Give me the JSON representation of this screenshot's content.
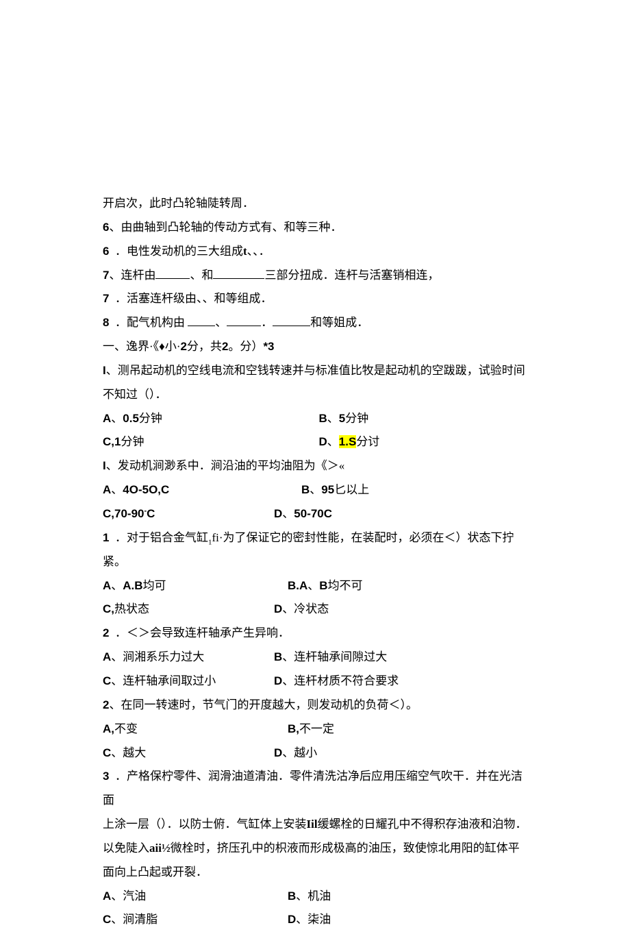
{
  "l0": "开启次，此时凸轮轴陡转周．",
  "l1a": "6",
  "l1b": "、由曲轴到凸轮轴的传动方式有、和等三种．",
  "l2a": "6",
  "l2b": "．电性发动机的三大组成",
  "l2c": "t",
  "l2d": "、、．",
  "l3a": "7",
  "l3b": "、连杆由",
  "l3c": "、和",
  "l3d": "三部分扭成．连杆与活塞销相连，",
  "l4a": "7",
  "l4b": "．活塞连杆级由、、和等组成．",
  "l5a": "8",
  "l5b": "．配气机构由 ",
  "l5c": "、",
  "l5d": "．",
  "l5e": "和等姐成．",
  "l6": "一、逸界·《♦小·",
  "l6b": "2",
  "l6c": "分，共",
  "l6d": "2",
  "l6e": "。分）",
  "l6f": "*3",
  "l7a": "I",
  "l7b": "、测吊起动机的空线电流和空钱转速并与标准值比牧是起动机的空跋跋，试验时间",
  "l8": "不知过（）．",
  "q1a1": "A",
  "q1a1t": "、",
  "q1a1v": "0.5",
  "q1a1s": "分钟",
  "q1b1": "B",
  "q1b1t": "、",
  "q1b1v": "5",
  "q1b1s": "分钟",
  "q1c1": "C,1",
  "q1c1s": "分钟",
  "q1d1": "D",
  "q1d1t": "、",
  "q1d1v": "1.S",
  "q1d1s": "分讨",
  "l11a": "I",
  "l11b": "、发动机涧渺系中．涧沿油的平均油阻为《＞«",
  "q2a": "A",
  "q2at": "、",
  "q2av": "4O-5O,C",
  "q2b": "B",
  "q2bt": "、",
  "q2bv": "95",
  "q2bs": "匕以上",
  "q2c": "C,70-90",
  "q2cs": "-",
  "q2ce": "C",
  "q2d": "D",
  "q2dt": "、",
  "q2dv": "50-70C",
  "l14a": "1",
  "l14b": "．对于铝合金气缸",
  "l14c": "1",
  "l14d": "fi·为了保证它的密封性能，在装配时，必须在＜）状态下拧紧。",
  "q3a": "A",
  "q3at": "、",
  "q3av": "A.B",
  "q3as": "均可",
  "q3b": "B.A",
  "q3bt": "、",
  "q3bv": "B",
  "q3bs": "均不可",
  "q3c": "C,",
  "q3cs": "热状态",
  "q3d": "D",
  "q3dt": "、冷状态",
  "l17a": "2",
  "l17b": "．＜＞会导致连杆轴承产生异响．",
  "q4a": "A",
  "q4at": "、涧湘系乐力过大",
  "q4b": "B",
  "q4bt": "、连杆轴承间隙过大",
  "q4c": "C",
  "q4ct": "、连杆轴承间取过小",
  "q4d": "D",
  "q4dt": "、连杆材质不符合要求",
  "l20a": "2",
  "l20b": "、在同一转速时，节气门的开度越大，则发动机的负荷＜）。",
  "q5a": "A,",
  "q5as": "不变",
  "q5b": "B,",
  "q5bs": "不一定",
  "q5c": "C",
  "q5ct": "、越大",
  "q5d": "D",
  "q5dt": "、越小",
  "l23a": "3",
  "l23b": "．产格保柠零件、润滑油道清油．零件清洗沽净后应用压缩空气吹干．并在光洁面",
  "l24": "上涂一层（）．以防士俯．气缸体上安装",
  "l24b": "Iil",
  "l24c": "缓螺栓的日耀孔中不得积存油液和泊物．",
  "l25": "以免陡入",
  "l25b": "aii½",
  "l25c": "微栓时，挤压孔中的枳液而形成极高的油压，致使惊北用阳的缸体平",
  "l26": "面向上凸起或开裂．",
  "q6a": "A",
  "q6at": "、汽油",
  "q6b": "B",
  "q6bt": "、机油",
  "q6c": "C",
  "q6ct": "、涧清脂",
  "q6d": "D",
  "q6dt": "、柒油"
}
